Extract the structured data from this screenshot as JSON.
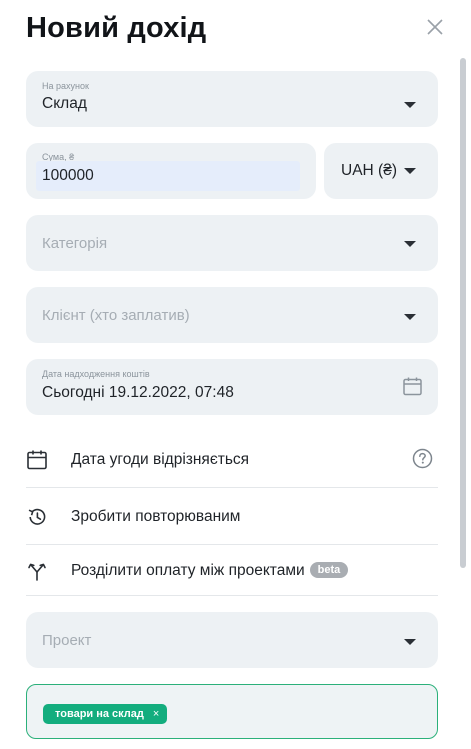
{
  "header": {
    "title": "Новий дохід"
  },
  "account": {
    "label": "На рахунок",
    "value": "Склад"
  },
  "amount": {
    "label": "Сума, ₴",
    "value": "100000"
  },
  "currency": {
    "value": "UAH (₴)"
  },
  "category": {
    "placeholder": "Категорія"
  },
  "client": {
    "placeholder": "Клієнт (хто заплатив)"
  },
  "date": {
    "label": "Дата надходження коштів",
    "value": "Сьогодні 19.12.2022, 07:48"
  },
  "options": {
    "deal_date": "Дата угоди відрізняється",
    "recurring": "Зробити повторюваним",
    "split": "Розділити оплату між проектами",
    "beta_badge": "beta"
  },
  "project": {
    "placeholder": "Проект"
  },
  "tags": [
    {
      "label": "товари на склад",
      "remove": "×"
    }
  ]
}
